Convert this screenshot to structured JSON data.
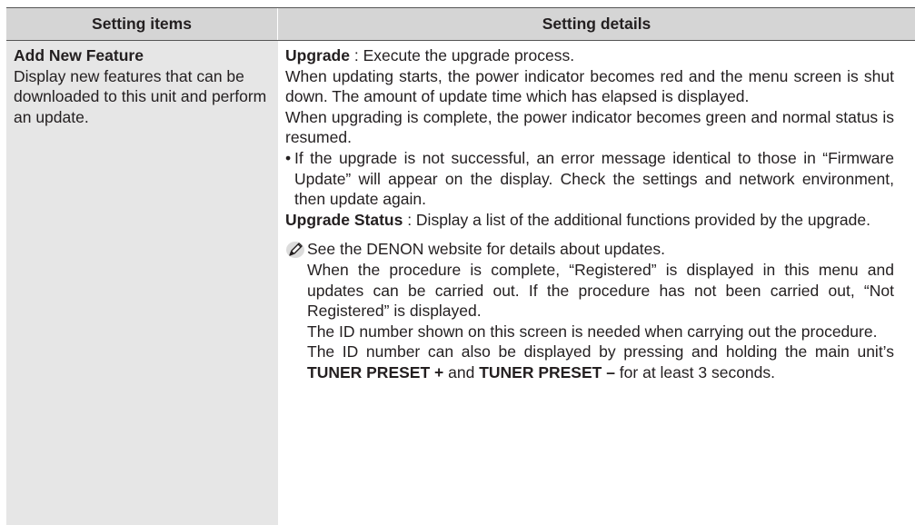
{
  "table": {
    "header_col1": "Setting items",
    "header_col2": "Setting details"
  },
  "item": {
    "name": "Add New Feature",
    "description": "Display new features that can be downloaded to this unit and perform an update."
  },
  "details": {
    "upgrade_term": "Upgrade",
    "upgrade_text": " : Execute the upgrade process.",
    "para1": "When updating starts, the power indicator becomes red and the menu screen is shut down. The amount of update time which has elapsed is displayed.",
    "para2": "When upgrading is complete, the power indicator becomes green and normal status is resumed.",
    "bullet_mark": "•",
    "bullet": "If the upgrade is not successful, an error message identical to those in “Firmware Update” will appear on the display. Check the settings and network environment, then update again.",
    "status_term": "Upgrade Status",
    "status_text": " : Display a list of the additional functions provided by the upgrade."
  },
  "note": {
    "icon": "pencil-icon",
    "line1": "See the DENON website for details about updates.",
    "line2": "When the procedure is complete, “Registered” is displayed in this menu and updates can be carried out. If the procedure has not been carried out, “Not Registered” is displayed.",
    "line3": "The ID number shown on this screen is needed when carrying out the procedure.",
    "line4_a": "The ID number can also be displayed by pressing and holding the main unit’s ",
    "line4_b": "TUNER PRESET +",
    "line4_c": " and ",
    "line4_d": "TUNER PRESET –",
    "line4_e": " for at least 3 seconds."
  }
}
